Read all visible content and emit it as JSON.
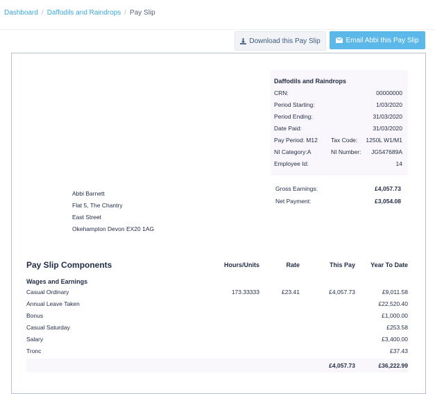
{
  "breadcrumb": {
    "dashboard": "Dashboard",
    "company": "Daffodils and Raindrops",
    "current": "Pay Slip"
  },
  "actions": {
    "download_label": "Download this Pay Slip",
    "email_label": "Email Abbi this Pay Slip"
  },
  "icons": {
    "download": "download-icon",
    "email": "envelope-icon"
  },
  "colors": {
    "accent": "#5bb8e8",
    "link": "#3aa8d8"
  },
  "employer": {
    "name": "Daffodils and Raindrops",
    "crn_label": "CRN:",
    "crn": "00000000",
    "period_start_label": "Period Starting:",
    "period_start": "1/03/2020",
    "period_end_label": "Period Ending:",
    "period_end": "31/03/2020",
    "date_paid_label": "Date Paid:",
    "date_paid": "31/03/2020",
    "pay_period": "Pay Period: M12",
    "tax_code_label": "Tax Code:",
    "tax_code": "1250L W1/M1",
    "ni_category": "NI Category:A",
    "ni_number_label": "NI Number:",
    "ni_number": "JG547689A",
    "employee_id_label": "Employee Id:",
    "employee_id": "14"
  },
  "totals": {
    "gross_label": "Gross Earnings:",
    "gross": "£4,057.73",
    "net_label": "Net Payment:",
    "net": "£3,054.08"
  },
  "address": {
    "name": "Abbi Barnett",
    "line1": "Flat 5, The Chantry",
    "line2": "East Street",
    "line3": "Okehampton Devon EX20 1AG"
  },
  "components": {
    "title": "Pay Slip Components",
    "headers": {
      "hours": "Hours/Units",
      "rate": "Rate",
      "this_pay": "This Pay",
      "ytd": "Year To Date"
    },
    "section": "Wages and Earnings",
    "rows": [
      {
        "name": "Casual Ordinary",
        "hours": "173.33333",
        "rate": "£23.41",
        "this_pay": "£4,057.73",
        "ytd": "£9,011.58"
      },
      {
        "name": "Annual Leave Taken",
        "hours": "",
        "rate": "",
        "this_pay": "",
        "ytd": "£22,520.40"
      },
      {
        "name": "Bonus",
        "hours": "",
        "rate": "",
        "this_pay": "",
        "ytd": "£1,000.00"
      },
      {
        "name": "Casual Saturday",
        "hours": "",
        "rate": "",
        "this_pay": "",
        "ytd": "£253.58"
      },
      {
        "name": "Salary",
        "hours": "",
        "rate": "",
        "this_pay": "",
        "ytd": "£3,400.00"
      },
      {
        "name": "Tronc",
        "hours": "",
        "rate": "",
        "this_pay": "",
        "ytd": "£37.43"
      }
    ],
    "total_this_pay": "£4,057.73",
    "total_ytd": "£36,222.99"
  }
}
